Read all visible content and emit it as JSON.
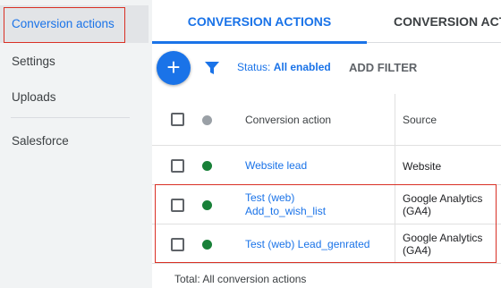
{
  "sidebar": {
    "items": [
      {
        "label": "Conversion actions"
      },
      {
        "label": "Settings"
      },
      {
        "label": "Uploads"
      },
      {
        "label": "Salesforce"
      }
    ]
  },
  "tabs": [
    {
      "label": "CONVERSION ACTIONS"
    },
    {
      "label": "CONVERSION ACTI"
    }
  ],
  "toolbar": {
    "add_symbol": "+",
    "status_prefix": "Status:",
    "status_value": "All enabled",
    "add_filter": "ADD FILTER"
  },
  "table": {
    "headers": {
      "name": "Conversion action",
      "source": "Source"
    },
    "rows": [
      {
        "name_line1": "Website lead",
        "name_line2": "",
        "source_line1": "Website",
        "source_line2": "",
        "status": "green"
      },
      {
        "name_line1": "Test (web)",
        "name_line2": "Add_to_wish_list",
        "source_line1": "Google Analytics",
        "source_line2": "(GA4)",
        "status": "green"
      },
      {
        "name_line1": "Test (web) Lead_genrated",
        "name_line2": "",
        "source_line1": "Google Analytics",
        "source_line2": "(GA4)",
        "status": "green"
      }
    ],
    "total_label": "Total: All conversion actions"
  },
  "colors": {
    "accent": "#1a73e8",
    "highlight_border": "#d93025",
    "status_enabled": "#188038"
  }
}
